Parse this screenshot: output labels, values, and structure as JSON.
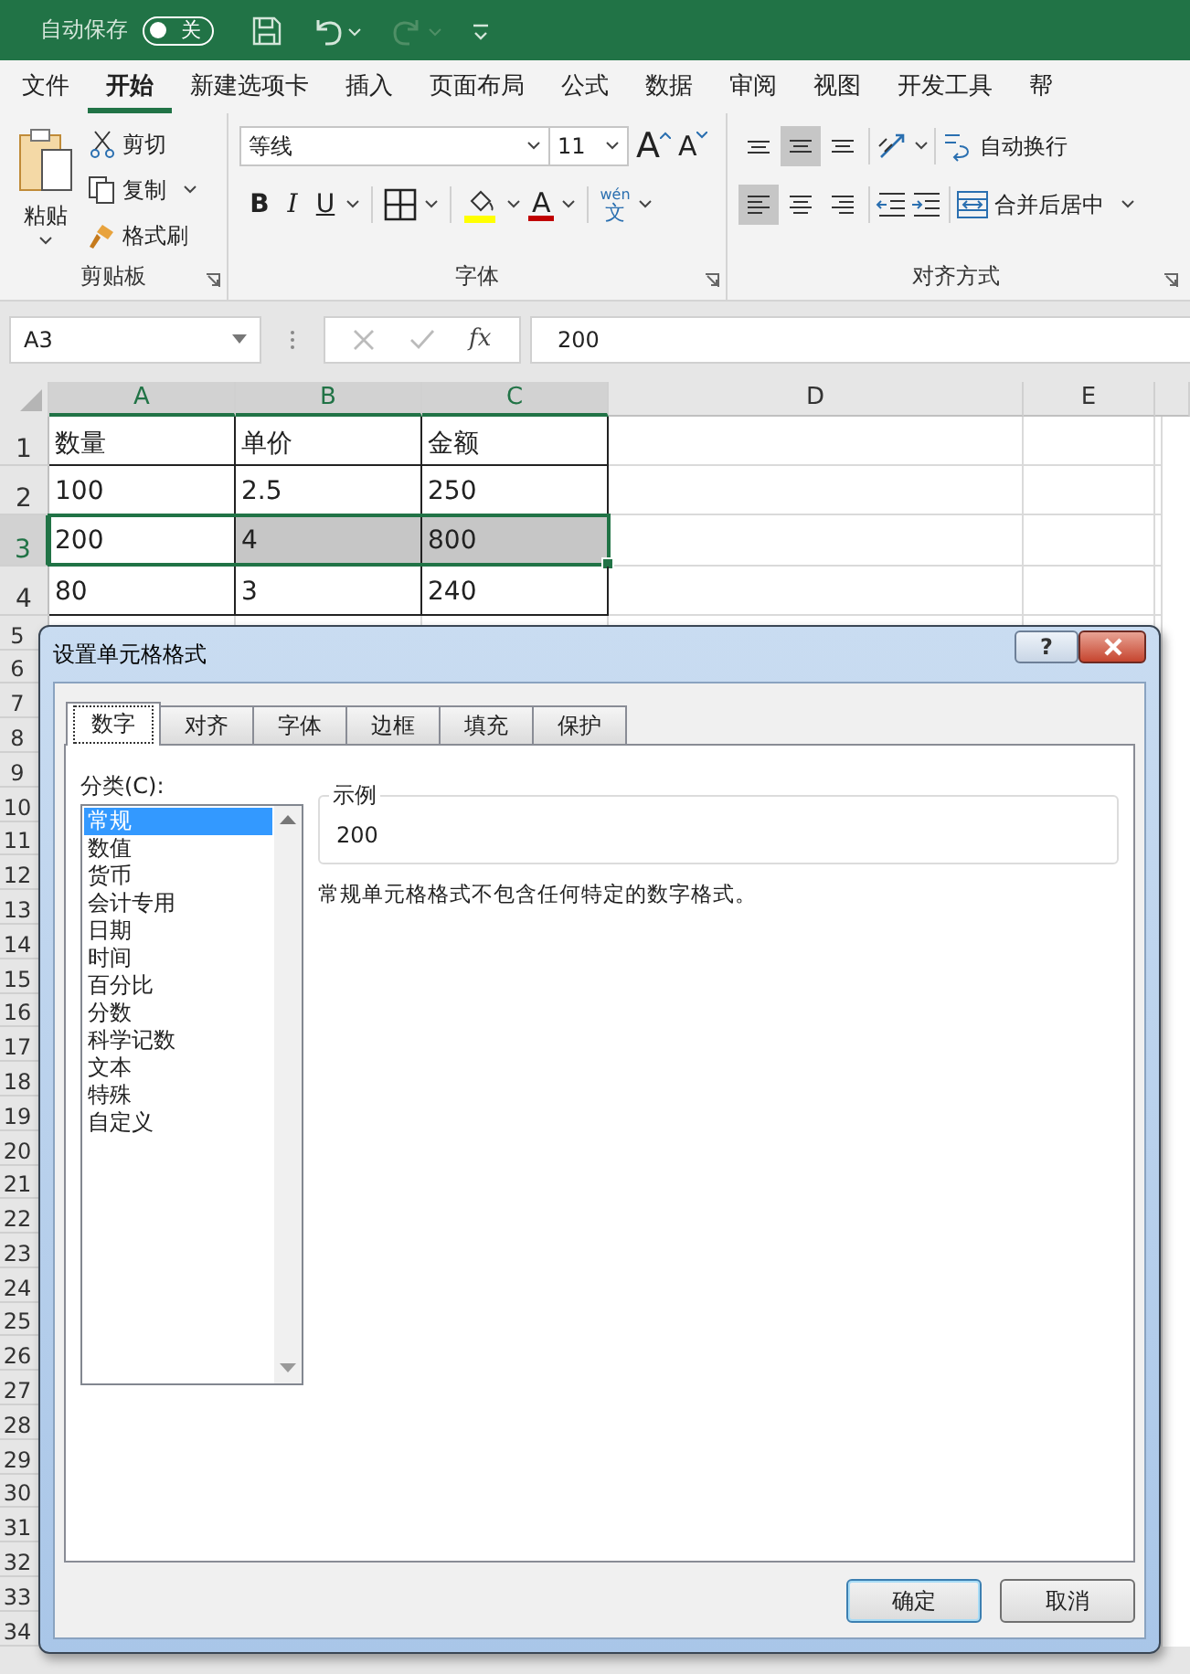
{
  "title_bar": {
    "autosave_label": "自动保存",
    "autosave_toggle": {
      "on": false,
      "label": "关"
    },
    "quick_access": [
      {
        "kind": "save",
        "disabled": false
      },
      {
        "kind": "undo",
        "disabled": false
      },
      {
        "kind": "redo",
        "disabled": true
      },
      {
        "kind": "customize",
        "disabled": false
      }
    ]
  },
  "menu_tabs": [
    {
      "label": "文件",
      "selected": false
    },
    {
      "label": "开始",
      "selected": true
    },
    {
      "label": "新建选项卡",
      "selected": false
    },
    {
      "label": "插入",
      "selected": false
    },
    {
      "label": "页面布局",
      "selected": false
    },
    {
      "label": "公式",
      "selected": false
    },
    {
      "label": "数据",
      "selected": false
    },
    {
      "label": "审阅",
      "selected": false
    },
    {
      "label": "视图",
      "selected": false
    },
    {
      "label": "开发工具",
      "selected": false
    },
    {
      "label": "帮",
      "selected": false
    }
  ],
  "ribbon": {
    "clipboard": {
      "paste": "粘贴",
      "cut": "剪切",
      "copy": "复制",
      "format_painter": "格式刷",
      "label": "剪贴板"
    },
    "font": {
      "font_name": "等线",
      "font_size": "11",
      "grow_font": "A",
      "shrink_font": "A",
      "bold": "B",
      "italic": "I",
      "underline": "U",
      "font_color": "A",
      "phonetic": "wén",
      "phonetic_char": "文",
      "label": "字体"
    },
    "alignment": {
      "vertical": [
        {
          "kind": "top",
          "selected": false
        },
        {
          "kind": "middle",
          "selected": true
        },
        {
          "kind": "bottom",
          "selected": false
        }
      ],
      "horizontal": [
        {
          "kind": "left",
          "selected": true
        },
        {
          "kind": "center",
          "selected": false
        },
        {
          "kind": "right",
          "selected": false
        }
      ],
      "wrap_text": "自动换行",
      "merge_center": "合并后居中",
      "label": "对齐方式"
    }
  },
  "formula_bar": {
    "name_box": "A3",
    "function_label": "fx",
    "value": "200"
  },
  "sheet": {
    "columns": [
      {
        "label": "A",
        "selected": true
      },
      {
        "label": "B",
        "selected": true
      },
      {
        "label": "C",
        "selected": true
      },
      {
        "label": "D",
        "selected": false
      },
      {
        "label": "E",
        "selected": false
      }
    ],
    "rows": [
      {
        "label": "1",
        "selected": false,
        "cells": [
          {
            "text": "数量",
            "highlighted": false
          },
          {
            "text": "单价",
            "highlighted": false
          },
          {
            "text": "金额",
            "highlighted": false
          }
        ]
      },
      {
        "label": "2",
        "selected": false,
        "cells": [
          {
            "text": "100",
            "highlighted": false
          },
          {
            "text": "2.5",
            "highlighted": false
          },
          {
            "text": "250",
            "highlighted": false
          }
        ]
      },
      {
        "label": "3",
        "selected": true,
        "cells": [
          {
            "text": "200",
            "highlighted": false
          },
          {
            "text": "4",
            "highlighted": true
          },
          {
            "text": "800",
            "highlighted": true
          }
        ]
      },
      {
        "label": "4",
        "selected": false,
        "cells": [
          {
            "text": "80",
            "highlighted": false
          },
          {
            "text": "3",
            "highlighted": false
          },
          {
            "text": "240",
            "highlighted": false
          }
        ]
      }
    ],
    "more_rows": [
      "5",
      "6",
      "7",
      "8",
      "9",
      "10",
      "11",
      "12",
      "13",
      "14",
      "15",
      "16",
      "17",
      "18",
      "19",
      "20",
      "21",
      "22",
      "23",
      "24",
      "25",
      "26",
      "27",
      "28",
      "29",
      "30",
      "31",
      "32",
      "33",
      "34"
    ]
  },
  "dialog": {
    "title": "设置单元格格式",
    "help": "?",
    "tabs": [
      {
        "label": "数字",
        "selected": true
      },
      {
        "label": "对齐",
        "selected": false
      },
      {
        "label": "字体",
        "selected": false
      },
      {
        "label": "边框",
        "selected": false
      },
      {
        "label": "填充",
        "selected": false
      },
      {
        "label": "保护",
        "selected": false
      }
    ],
    "category_label": "分类(C):",
    "categories": [
      {
        "label": "常规",
        "selected": true
      },
      {
        "label": "数值",
        "selected": false
      },
      {
        "label": "货币",
        "selected": false
      },
      {
        "label": "会计专用",
        "selected": false
      },
      {
        "label": "日期",
        "selected": false
      },
      {
        "label": "时间",
        "selected": false
      },
      {
        "label": "百分比",
        "selected": false
      },
      {
        "label": "分数",
        "selected": false
      },
      {
        "label": "科学记数",
        "selected": false
      },
      {
        "label": "文本",
        "selected": false
      },
      {
        "label": "特殊",
        "selected": false
      },
      {
        "label": "自定义",
        "selected": false
      }
    ],
    "sample_label": "示例",
    "sample_value": "200",
    "description": "常规单元格格式不包含任何特定的数字格式。",
    "buttons": [
      {
        "label": "确定",
        "default": true
      },
      {
        "label": "取消",
        "default": false
      }
    ]
  }
}
